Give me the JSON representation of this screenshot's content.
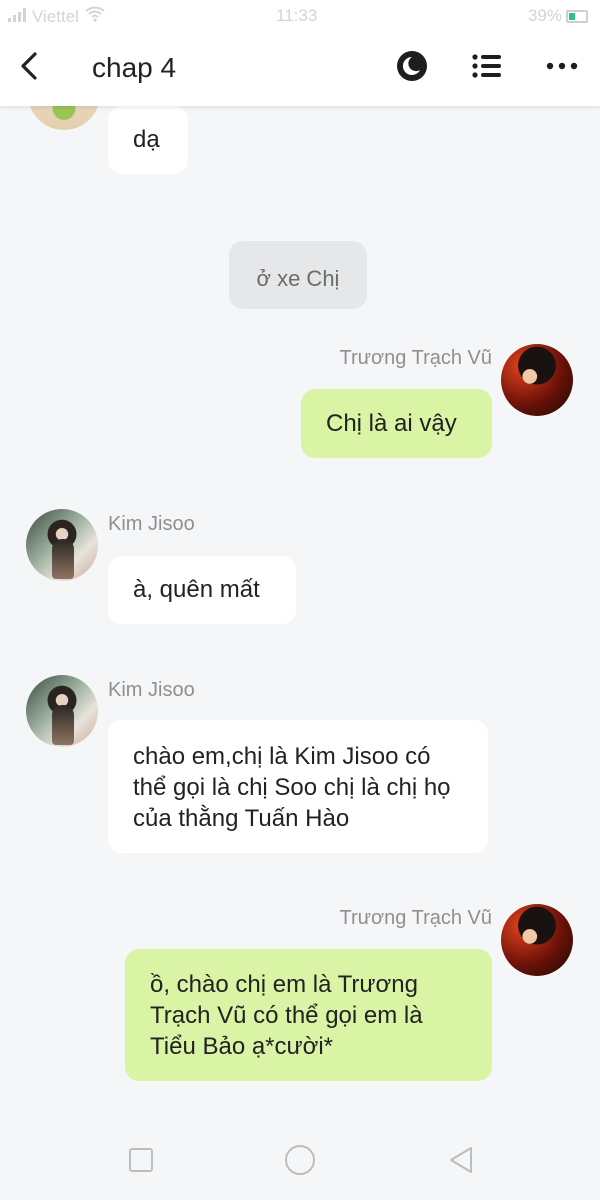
{
  "status_bar": {
    "carrier": "Viettel",
    "time": "11:33",
    "battery": "39%",
    "battery_level": 0.39,
    "icons": [
      "signal-icon",
      "wifi-icon",
      "battery-icon"
    ]
  },
  "header": {
    "title": "chap 4",
    "icons": [
      "back-arrow-icon",
      "theme-toggle-icon",
      "list-icon",
      "more-icon"
    ]
  },
  "messages": [
    {
      "side": "left",
      "sender": "",
      "text": "dạ",
      "avatar": "partial-avatar"
    },
    {
      "side": "center",
      "text": "ở xe Chị"
    },
    {
      "side": "right",
      "sender": "Trương Trạch Vũ",
      "text": "Chị là ai vậy"
    },
    {
      "side": "left",
      "sender": "Kim Jisoo",
      "text": "à, quên mất"
    },
    {
      "side": "left",
      "sender": "Kim Jisoo",
      "text": "chào em,chị là Kim Jisoo có thể gọi là chị Soo chị là chị họ của thằng Tuấn Hào"
    },
    {
      "side": "right",
      "sender": "Trương Trạch Vũ",
      "text": "ồ, chào chị em là Trương Trạch Vũ có thể gọi em là Tiểu Bảo ạ*cười*"
    }
  ],
  "nav_bar": {
    "icons": [
      "recent-apps-icon",
      "home-icon",
      "back-icon"
    ]
  },
  "colors": {
    "background": "#f5f6f8",
    "bubble_left": "#ffffff",
    "bubble_right": "#d9f4a4",
    "bubble_system": "#e6e7e9",
    "name_text": "#8f8f8f"
  }
}
